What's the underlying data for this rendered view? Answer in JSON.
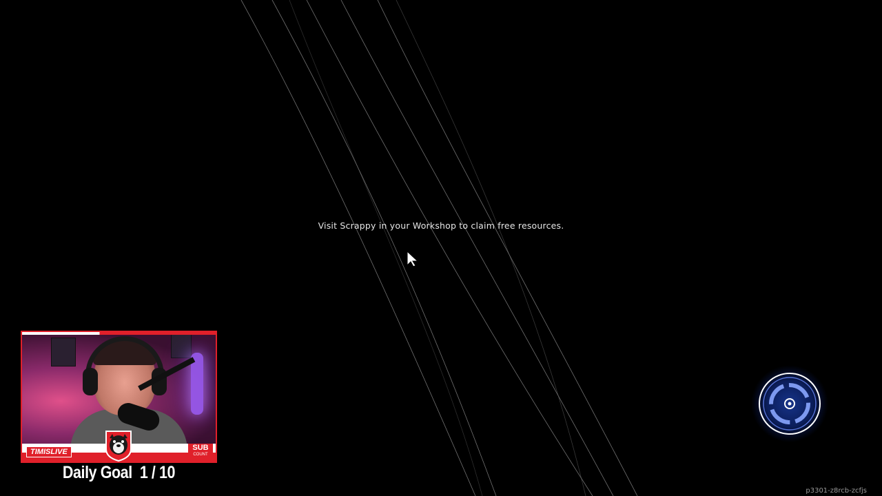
{
  "game": {
    "loading_hint": "Visit Scrappy in your Workshop to claim free resources.",
    "build_id": "p3301-z8rcb-zcfjs",
    "loader_color": "#4a7cff"
  },
  "stream_overlay": {
    "channel_name": "TIMISLIVE",
    "sub_label_top": "SUB",
    "sub_label_bottom": "COUNT",
    "daily_goal_label": "Daily Goal",
    "daily_goal_value": "1 / 10",
    "accent_color": "#e0202a"
  },
  "icons": {
    "cursor": "mouse-pointer-icon",
    "loader": "loading-spinner-icon",
    "logo": "dog-mascot-logo"
  }
}
